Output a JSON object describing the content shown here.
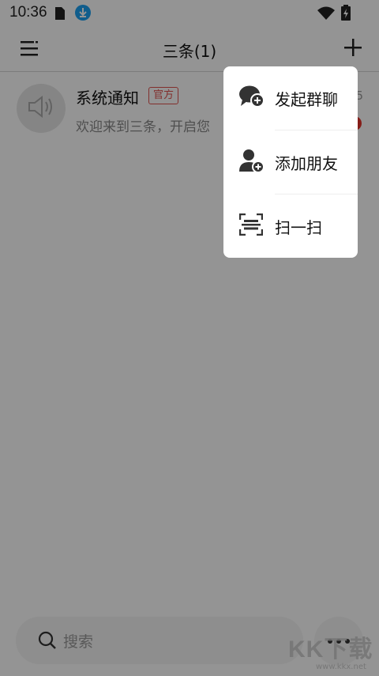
{
  "status_bar": {
    "time": "10:36",
    "icons": [
      "sim-card-icon",
      "download-icon",
      "wifi-icon",
      "battery-icon"
    ],
    "download_color": "#1da1f2"
  },
  "header": {
    "title": "三条(1)",
    "left_icon": "menu-icon",
    "right_icon": "plus-icon"
  },
  "conversation": {
    "name": "系统通知",
    "badge": "官方",
    "preview": "欢迎来到三条，开启您",
    "time": "5",
    "avatar_icon": "speaker-icon",
    "badge_color": "#e0524e",
    "unread_color": "#e5332a"
  },
  "search": {
    "placeholder": "搜索"
  },
  "more_icon": "more-icon",
  "popup_menu": {
    "items": [
      {
        "label": "发起群聊",
        "icon": "group-chat-add-icon"
      },
      {
        "label": "添加朋友",
        "icon": "add-friend-icon"
      },
      {
        "label": "扫一扫",
        "icon": "scan-icon"
      }
    ]
  },
  "watermark": {
    "text": "KK下载",
    "sub": "www.kkx.net"
  }
}
